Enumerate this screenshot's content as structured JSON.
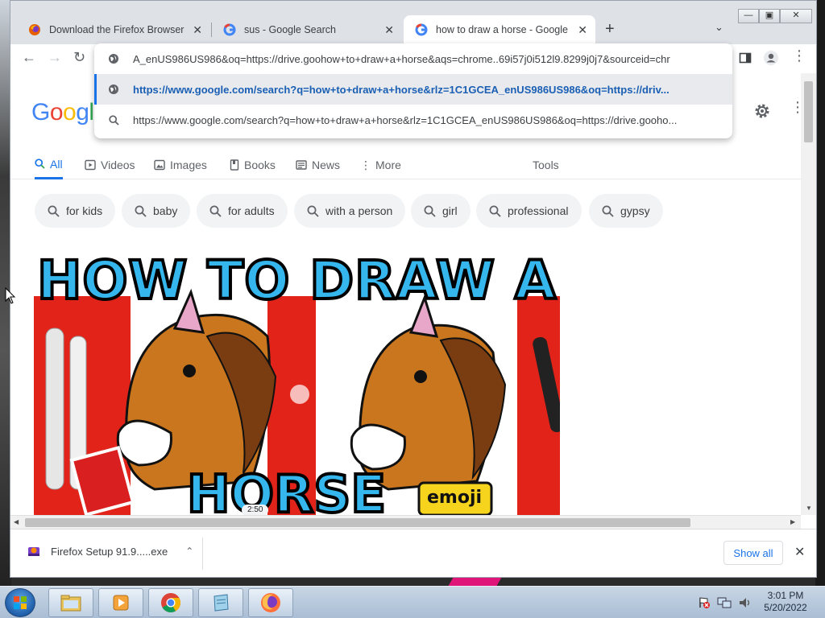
{
  "tabs": [
    {
      "title": "Download the Firefox Browser in",
      "active": false
    },
    {
      "title": "sus - Google Search",
      "active": false
    },
    {
      "title": "how to draw a horse - Google Se",
      "active": true
    }
  ],
  "omnibox": {
    "input_text": "A_enUS986US986&oq=https://drive.goohow+to+draw+a+horse&aqs=chrome..69i57j0i512l9.8299j0j7&sourceid=chr",
    "suggestions": [
      {
        "text": "https://www.google.com/search?q=how+to+draw+a+horse&rlz=1C1GCEA_enUS986US986&oq=https://driv...",
        "icon": "globe-icon",
        "selected": true
      },
      {
        "text": "https://www.google.com/search?q=how+to+draw+a+horse&rlz=1C1GCEA_enUS986US986&oq=https://drive.gooho...",
        "icon": "search-icon",
        "selected": false
      }
    ]
  },
  "google": {
    "logo_text": "Googl",
    "nav_tabs": [
      {
        "label": "All",
        "icon": "search-icon",
        "active": true
      },
      {
        "label": "Videos",
        "icon": "video-icon",
        "active": false
      },
      {
        "label": "Images",
        "icon": "image-icon",
        "active": false
      },
      {
        "label": "Books",
        "icon": "book-icon",
        "active": false
      },
      {
        "label": "News",
        "icon": "news-icon",
        "active": false
      },
      {
        "label": "More",
        "icon": "more-vert-icon",
        "active": false
      }
    ],
    "tools_label": "Tools",
    "chips": [
      "for kids",
      "baby",
      "for adults",
      "with a person",
      "girl",
      "professional",
      "gypsy"
    ],
    "video": {
      "thumb_title": "HOW TO DRAW A",
      "thumb_subtitle": "HORSE",
      "thumb_badge": "emoji",
      "duration": "2:50"
    }
  },
  "downloads": {
    "item_label": "Firefox Setup 91.9.....exe",
    "show_all_label": "Show all"
  },
  "taskbar": {
    "time": "3:01 PM",
    "date": "5/20/2022"
  },
  "colors": {
    "accent": "#1a73e8",
    "chip_bg": "#f1f3f4",
    "tabstrip_bg": "#dee1e6"
  }
}
